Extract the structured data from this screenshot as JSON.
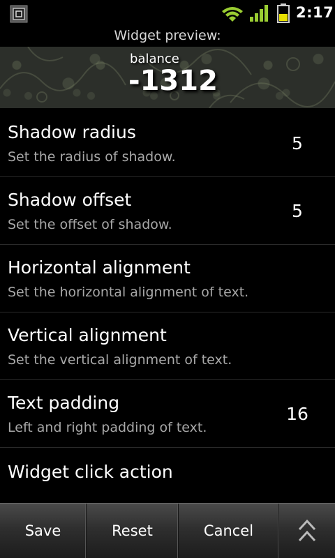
{
  "status_bar": {
    "time": "2:17",
    "icons": [
      "notification-icon",
      "wifi-icon",
      "signal-icon",
      "battery-icon"
    ],
    "accent_color": "#9acd32"
  },
  "preview": {
    "label": "Widget preview:",
    "balance_label": "balance",
    "balance_value": "-1312"
  },
  "settings": [
    {
      "title": "Shadow radius",
      "summary": "Set the radius of shadow.",
      "value": "5"
    },
    {
      "title": "Shadow offset",
      "summary": "Set the offset of shadow.",
      "value": "5"
    },
    {
      "title": "Horizontal alignment",
      "summary": "Set the horizontal alignment of text.",
      "value": ""
    },
    {
      "title": "Vertical alignment",
      "summary": "Set the vertical alignment of text.",
      "value": ""
    },
    {
      "title": "Text padding",
      "summary": "Left and right padding of text.",
      "value": "16"
    },
    {
      "title": "Widget click action",
      "summary": "",
      "value": ""
    }
  ],
  "toolbar": {
    "save_label": "Save",
    "reset_label": "Reset",
    "cancel_label": "Cancel",
    "more_icon": "double-chevron-up-icon"
  }
}
